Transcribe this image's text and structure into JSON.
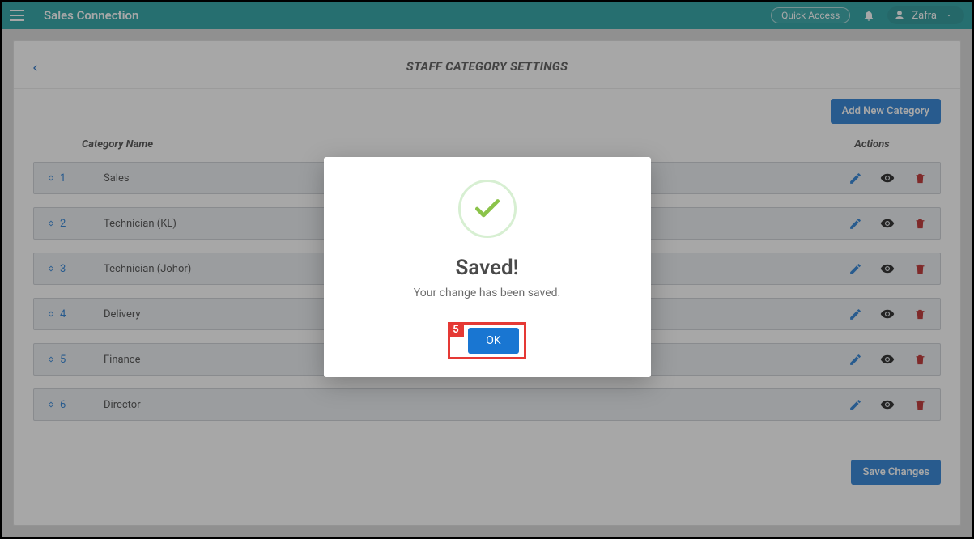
{
  "header": {
    "brand": "Sales Connection",
    "quick_access": "Quick Access",
    "username": "Zafra"
  },
  "page": {
    "title": "STAFF CATEGORY SETTINGS",
    "add_button": "Add New Category",
    "col_name": "Category Name",
    "col_actions": "Actions",
    "save_button": "Save Changes"
  },
  "categories": [
    {
      "index": "1",
      "name": "Sales"
    },
    {
      "index": "2",
      "name": "Technician (KL)"
    },
    {
      "index": "3",
      "name": "Technician (Johor)"
    },
    {
      "index": "4",
      "name": "Delivery"
    },
    {
      "index": "5",
      "name": "Finance"
    },
    {
      "index": "6",
      "name": "Director"
    }
  ],
  "modal": {
    "title": "Saved!",
    "subtitle": "Your change has been saved.",
    "ok": "OK",
    "annotation": "5"
  },
  "icons": {
    "edit_color": "#1976d2",
    "eye_color": "#222",
    "trash_color": "#b71c1c",
    "check_color": "#8bc34a"
  }
}
